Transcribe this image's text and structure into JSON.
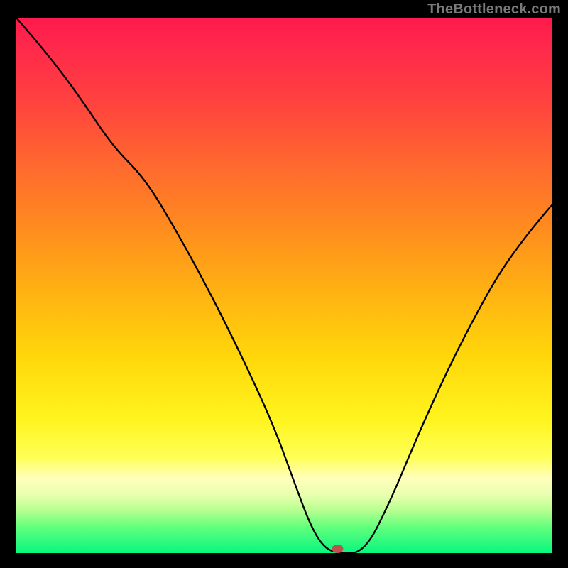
{
  "watermark": "TheBottleneck.com",
  "colors": {
    "background": "#000000",
    "curve": "#000000",
    "marker": "#c0504d",
    "gradient_top": "#ff1a4d",
    "gradient_bottom": "#06f77f"
  },
  "chart_data": {
    "type": "line",
    "title": "",
    "xlabel": "",
    "ylabel": "",
    "xlim": [
      0,
      100
    ],
    "ylim": [
      0,
      100
    ],
    "grid": false,
    "legend": false,
    "series": [
      {
        "name": "bottleneck-curve",
        "x": [
          0,
          6,
          12,
          18,
          24,
          30,
          36,
          42,
          48,
          52,
          55,
          57.5,
          60,
          65,
          70,
          75,
          80,
          85,
          90,
          95,
          100
        ],
        "y": [
          100,
          93,
          85,
          76,
          70,
          60,
          49,
          37,
          24,
          13,
          5,
          1,
          0,
          0,
          10,
          22,
          33,
          43,
          52,
          59,
          65
        ]
      }
    ],
    "marker": {
      "x": 60,
      "y": 0.8,
      "shape": "ellipse",
      "color": "#c0504d"
    },
    "notes": "V-shaped curve over vertical red→green heat gradient; minimum at ~x=57–60, flat along bottom between ~57.5 and ~65, then rises again. Values estimated from pixel positions; no axes/ticks shown."
  }
}
